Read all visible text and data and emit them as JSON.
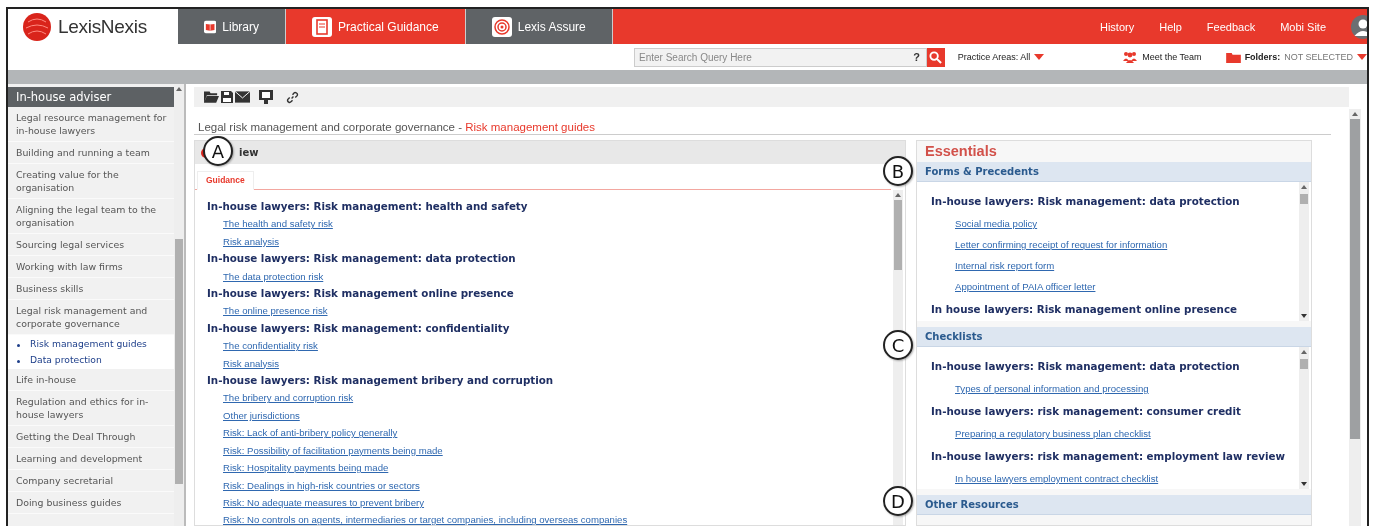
{
  "header": {
    "logo": "LexisNexis",
    "tabs": [
      {
        "label": "Library",
        "kind": "library",
        "selected": false
      },
      {
        "label": "Practical Guidance",
        "kind": "guidance",
        "selected": true
      },
      {
        "label": "Lexis Assure",
        "kind": "assure",
        "selected": false
      }
    ],
    "links": [
      "History",
      "Help",
      "Feedback",
      "Mobi Site"
    ]
  },
  "search": {
    "placeholder": "Enter Search Query Here",
    "help": "?",
    "practice_label": "Practice Areas:",
    "practice_value": "All",
    "meet_team": "Meet the Team",
    "folders_label": "Folders:",
    "folders_value": "NOT SELECTED"
  },
  "sidebar": {
    "title": "In-house adviser",
    "items": [
      {
        "label": "Legal resource management for in-house lawyers"
      },
      {
        "label": "Building and running a team"
      },
      {
        "label": "Creating value for the organisation"
      },
      {
        "label": "Aligning the legal team to the organisation"
      },
      {
        "label": "Sourcing legal services"
      },
      {
        "label": "Working with law firms"
      },
      {
        "label": "Business skills"
      },
      {
        "label": "Legal risk management and corporate governance",
        "children": [
          {
            "label": "Risk management guides"
          },
          {
            "label": "Data protection"
          }
        ]
      },
      {
        "label": "Life in-house"
      },
      {
        "label": "Regulation and ethics for in-house lawyers"
      },
      {
        "label": "Getting the Deal Through"
      },
      {
        "label": "Learning and development"
      },
      {
        "label": "Company secretarial"
      },
      {
        "label": "Doing business guides"
      }
    ]
  },
  "breadcrumb": {
    "path": "Legal risk management and corporate governance",
    "separator": "-",
    "current": "Risk management guides"
  },
  "guidance_panel": {
    "title": "iew",
    "tabs": [
      {
        "label": "Guidance",
        "selected": true
      }
    ],
    "groups": [
      {
        "heading": "In-house lawyers: Risk management: health and safety",
        "links": [
          "The health and safety risk",
          "Risk analysis"
        ]
      },
      {
        "heading": "In-house lawyers: Risk management: data protection",
        "links": [
          "The data protection risk"
        ]
      },
      {
        "heading": "In-house lawyers: Risk management online presence",
        "links": [
          "The online presence risk"
        ]
      },
      {
        "heading": "In-house lawyers: Risk management: confidentiality",
        "links": [
          "The confidentiality risk",
          "Risk analysis"
        ]
      },
      {
        "heading": "In-house lawyers: Risk management bribery and corruption",
        "links": [
          "The bribery and corruption risk",
          "Other jurisdictions",
          "Risk: Lack of anti-bribery policy generally",
          "Risk: Possibility of facilitation payments being made",
          "Risk: Hospitality payments being made",
          "Risk: Dealings in high-risk countries or sectors",
          "Risk: No adequate measures to prevent bribery",
          "Risk: No controls on agents, intermediaries or target companies, including overseas companies"
        ]
      }
    ]
  },
  "essentials": {
    "title": "Essentials",
    "sections": [
      {
        "title": "Forms & Precedents",
        "groups": [
          {
            "heading": "In-house lawyers: Risk management: data protection",
            "links": [
              "Social media policy",
              "Letter confirming receipt of request for information",
              "Internal risk report form ",
              "Appointment of PAIA officer letter"
            ]
          },
          {
            "heading": "In house lawyers: Risk management online presence"
          }
        ]
      },
      {
        "title": "Checklists",
        "groups": [
          {
            "heading": "In-house lawyers: Risk management: data protection",
            "links": [
              "Types of personal information and processing"
            ]
          },
          {
            "heading": "In-house lawyers: risk management: consumer credit",
            "links": [
              "Preparing a regulatory business plan checklist"
            ]
          },
          {
            "heading": "In-house lawyers: risk management: employment law review",
            "links": [
              "In house lawyers employment contract checklist"
            ]
          }
        ]
      },
      {
        "title": "Other Resources"
      }
    ]
  },
  "callouts": [
    "A",
    "B",
    "C",
    "D"
  ]
}
